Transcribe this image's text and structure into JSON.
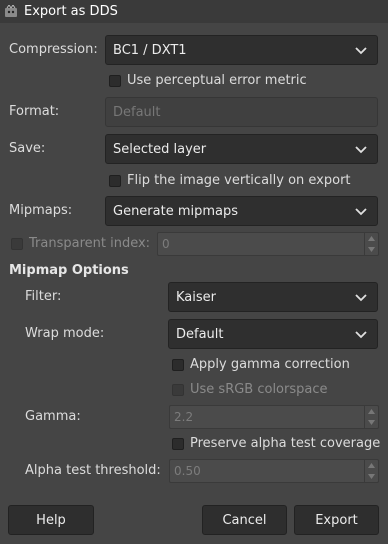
{
  "window": {
    "title": "Export as DDS",
    "icon": "gimp-app-icon"
  },
  "compression": {
    "label": "Compression:",
    "value": "BC1 / DXT1"
  },
  "perceptual_metric": {
    "label": "Use perceptual error metric",
    "checked": false
  },
  "format": {
    "label": "Format:",
    "value": "Default",
    "enabled": false
  },
  "save": {
    "label": "Save:",
    "value": "Selected layer"
  },
  "flip_vertical": {
    "label": "Flip the image vertically on export",
    "checked": false
  },
  "mipmaps": {
    "label": "Mipmaps:",
    "value": "Generate mipmaps"
  },
  "transparent_index": {
    "label": "Transparent index:",
    "value": "0",
    "checked": false,
    "enabled": false
  },
  "mipmap_options": {
    "heading": "Mipmap Options",
    "filter": {
      "label": "Filter:",
      "value": "Kaiser"
    },
    "wrap_mode": {
      "label": "Wrap mode:",
      "value": "Default"
    },
    "gamma_correction": {
      "label": "Apply gamma correction",
      "checked": false
    },
    "srgb": {
      "label": "Use sRGB colorspace",
      "checked": false,
      "enabled": false
    },
    "gamma": {
      "label": "Gamma:",
      "value": "2.2",
      "enabled": false
    },
    "preserve_alpha": {
      "label": "Preserve alpha test coverage",
      "checked": false
    },
    "alpha_threshold": {
      "label": "Alpha test threshold:",
      "value": "0.50",
      "enabled": false
    }
  },
  "buttons": {
    "help": "Help",
    "cancel": "Cancel",
    "export": "Export"
  },
  "colors": {
    "background": "#454545",
    "titlebar": "#3a3a3a",
    "field": "#2f2f2f",
    "text": "#dcdcdc"
  }
}
